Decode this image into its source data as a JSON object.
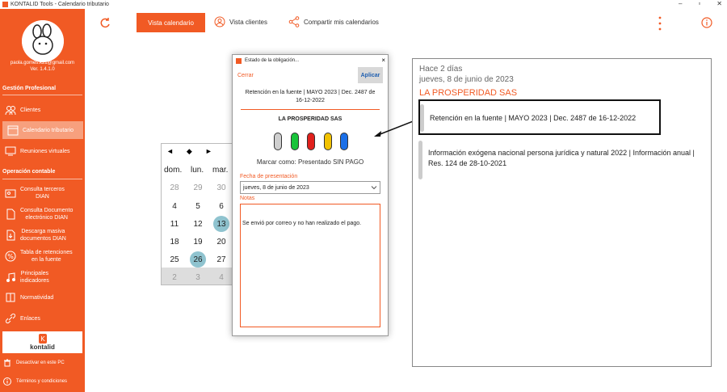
{
  "window": {
    "title": "KONTALID Tools - Calendario tributario"
  },
  "sidebar": {
    "email": "paola.gomes.k21@gmail.com",
    "version": "Ver. 1.4.1.0",
    "section1": "Gestión Profesional",
    "section2": "Operación contable",
    "items": [
      {
        "label": "Clientes"
      },
      {
        "label": "Calendario tributario"
      },
      {
        "label": "Reuniones virtuales"
      },
      {
        "label": "Consulta terceros\nDIAN"
      },
      {
        "label": "Consulta Documento\nelectrónico DIAN"
      },
      {
        "label": "Descarga masiva\ndocumentos DIAN"
      },
      {
        "label": "Tabla de retenciones\nen la fuente"
      },
      {
        "label": "Principales\nindicadores"
      },
      {
        "label": "Normatividad"
      },
      {
        "label": "Enlaces"
      }
    ],
    "logo_text": "kontalid",
    "footer1": "Desactivar en este PC",
    "footer2": "Términos y condiciones"
  },
  "toolbar": {
    "tab_calendar": "Vista calendario",
    "tab_clients": "Vista clientes",
    "tab_share": "Compartir mis calendarios"
  },
  "calendar": {
    "nav": [
      "◄",
      "◆",
      "►"
    ],
    "headers": [
      "dom.",
      "lun.",
      "mar."
    ],
    "rows": [
      [
        "28",
        "29",
        "30"
      ],
      [
        "4",
        "5",
        "6"
      ],
      [
        "11",
        "12",
        "13"
      ],
      [
        "18",
        "19",
        "20"
      ],
      [
        "25",
        "26",
        "27"
      ],
      [
        "2",
        "3",
        "4"
      ]
    ]
  },
  "dialog": {
    "title": "Estado de la obligación...",
    "close": "×",
    "cerrar": "Cerrar",
    "aplicar": "Aplicar",
    "description": "Retención en la fuente | MAYO 2023 | Dec. 2487 de 16-12-2022",
    "company": "LA PROSPERIDAD SAS",
    "marcar": "Marcar como: Presentado SIN PAGO",
    "fecha_label": "Fecha de presentación",
    "fecha_value": "jueves, 8 de junio de 2023",
    "notas_label": "Notas",
    "notas_value": "Se envió por correo y no han realizado el pago."
  },
  "status_colors": [
    "#cfcfcf",
    "#18c43a",
    "#e0201c",
    "#f2c200",
    "#1a6fe8"
  ],
  "right_panel": {
    "ago": "Hace 2 días",
    "date": "jueves, 8 de junio de 2023",
    "company": "LA PROSPERIDAD SAS",
    "card1": "Retención en la fuente | MAYO 2023 | Dec. 2487 de 16-12-2022",
    "card2": "Información exógena nacional persona jurídica y natural 2022 | Información anual | Res. 124 de 28-10-2021"
  },
  "accent": "#f15a24"
}
